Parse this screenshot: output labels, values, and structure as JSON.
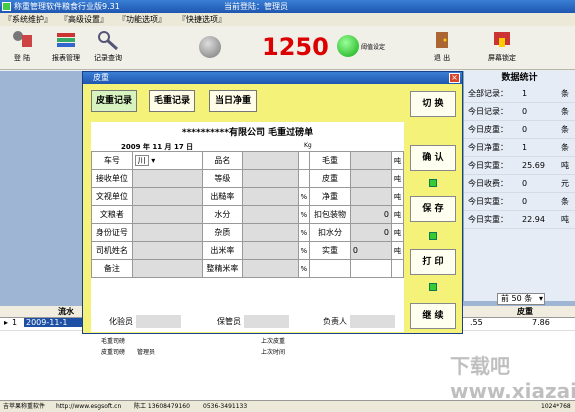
{
  "window": {
    "title": "称重管理软件粮食行业版9.31",
    "login": "当前登陆：管理员"
  },
  "menu": [
    "『系统维护』",
    "『高级设置』",
    "『功能选项』",
    "『快捷选项』"
  ],
  "toolbar": {
    "login": "登 陆",
    "report": "报表管理",
    "records": "记录查询",
    "threshold": "阈值设定",
    "exit": "退 出",
    "lock": "屏幕锁定"
  },
  "display": {
    "weight": "1250"
  },
  "dialog": {
    "title": "皮重",
    "tabs": [
      "皮重记录",
      "毛重记录",
      "当日净重"
    ],
    "side": {
      "switch": "切 换",
      "confirm": "确 认",
      "save": "保 存",
      "print": "打 印",
      "continue": "继 续"
    },
    "header": "**********有限公司 毛重过磅单",
    "date": "2009 年 11 月 17 日",
    "kg": "Kg",
    "rows": [
      {
        "l1": "车号",
        "v1": "川",
        "l2": "品名",
        "u2": "",
        "l3": "毛重",
        "u3": "吨"
      },
      {
        "l1": "接收单位",
        "v1": "",
        "l2": "等级",
        "u2": "",
        "l3": "皮重",
        "u3": "吨"
      },
      {
        "l1": "文视单位",
        "v1": "",
        "l2": "出糙率",
        "u2": "%",
        "l3": "净重",
        "u3": "吨"
      },
      {
        "l1": "文粮者",
        "v1": "",
        "l2": "水分",
        "u2": "%",
        "l3": "扣包装物",
        "v3": "0",
        "u3": "吨"
      },
      {
        "l1": "身份证号",
        "v1": "",
        "l2": "杂质",
        "u2": "%",
        "l3": "扣水分",
        "v3": "0",
        "u3": "吨"
      },
      {
        "l1": "司机姓名",
        "v1": "",
        "l2": "出米率",
        "u2": "%",
        "l3": "实重",
        "v3": "0",
        "u3": "吨"
      },
      {
        "l1": "备注",
        "v1": "",
        "l2": "整精米率",
        "u2": "%",
        "l3": "",
        "u3": ""
      }
    ],
    "below": {
      "inspector": "化验员",
      "keeper": "保管员",
      "manager": "负责人"
    },
    "foot": {
      "gross_op": "毛重司磅",
      "tare_op": "皮重司磅",
      "tare_op_val": "管理员",
      "last_tare": "上次皮重",
      "last_time": "上次时间"
    }
  },
  "stats": {
    "title": "数据统计",
    "rows": [
      {
        "label": "全部记录：",
        "value": "1",
        "unit": "条"
      },
      {
        "label": "今日记录：",
        "value": "0",
        "unit": "条"
      },
      {
        "label": "今日皮重：",
        "value": "0",
        "unit": "条"
      },
      {
        "label": "今日净重：",
        "value": "1",
        "unit": "条"
      },
      {
        "label": "今日实重：",
        "value": "25.69",
        "unit": "吨"
      },
      {
        "label": "今日收费：",
        "value": "0",
        "unit": "元"
      },
      {
        "label": "今日实重：",
        "value": "0",
        "unit": "条"
      },
      {
        "label": "今日实重：",
        "value": "22.94",
        "unit": "吨"
      }
    ],
    "filter": "前 50 条"
  },
  "grid": {
    "col_a": "流水",
    "col_b": "皮重",
    "row_num": "1",
    "row_date": "2009-11-1",
    "val_a": ".55",
    "val_b": "7.86"
  },
  "status": {
    "left": "吉苹果称重软件",
    "url": "http://www.esgsoft.cn",
    "contact": "陈工 13608479160",
    "phone": "0536-3491133",
    "res": "1024*768"
  },
  "watermark": "下载吧 www.xiazaiba.com"
}
